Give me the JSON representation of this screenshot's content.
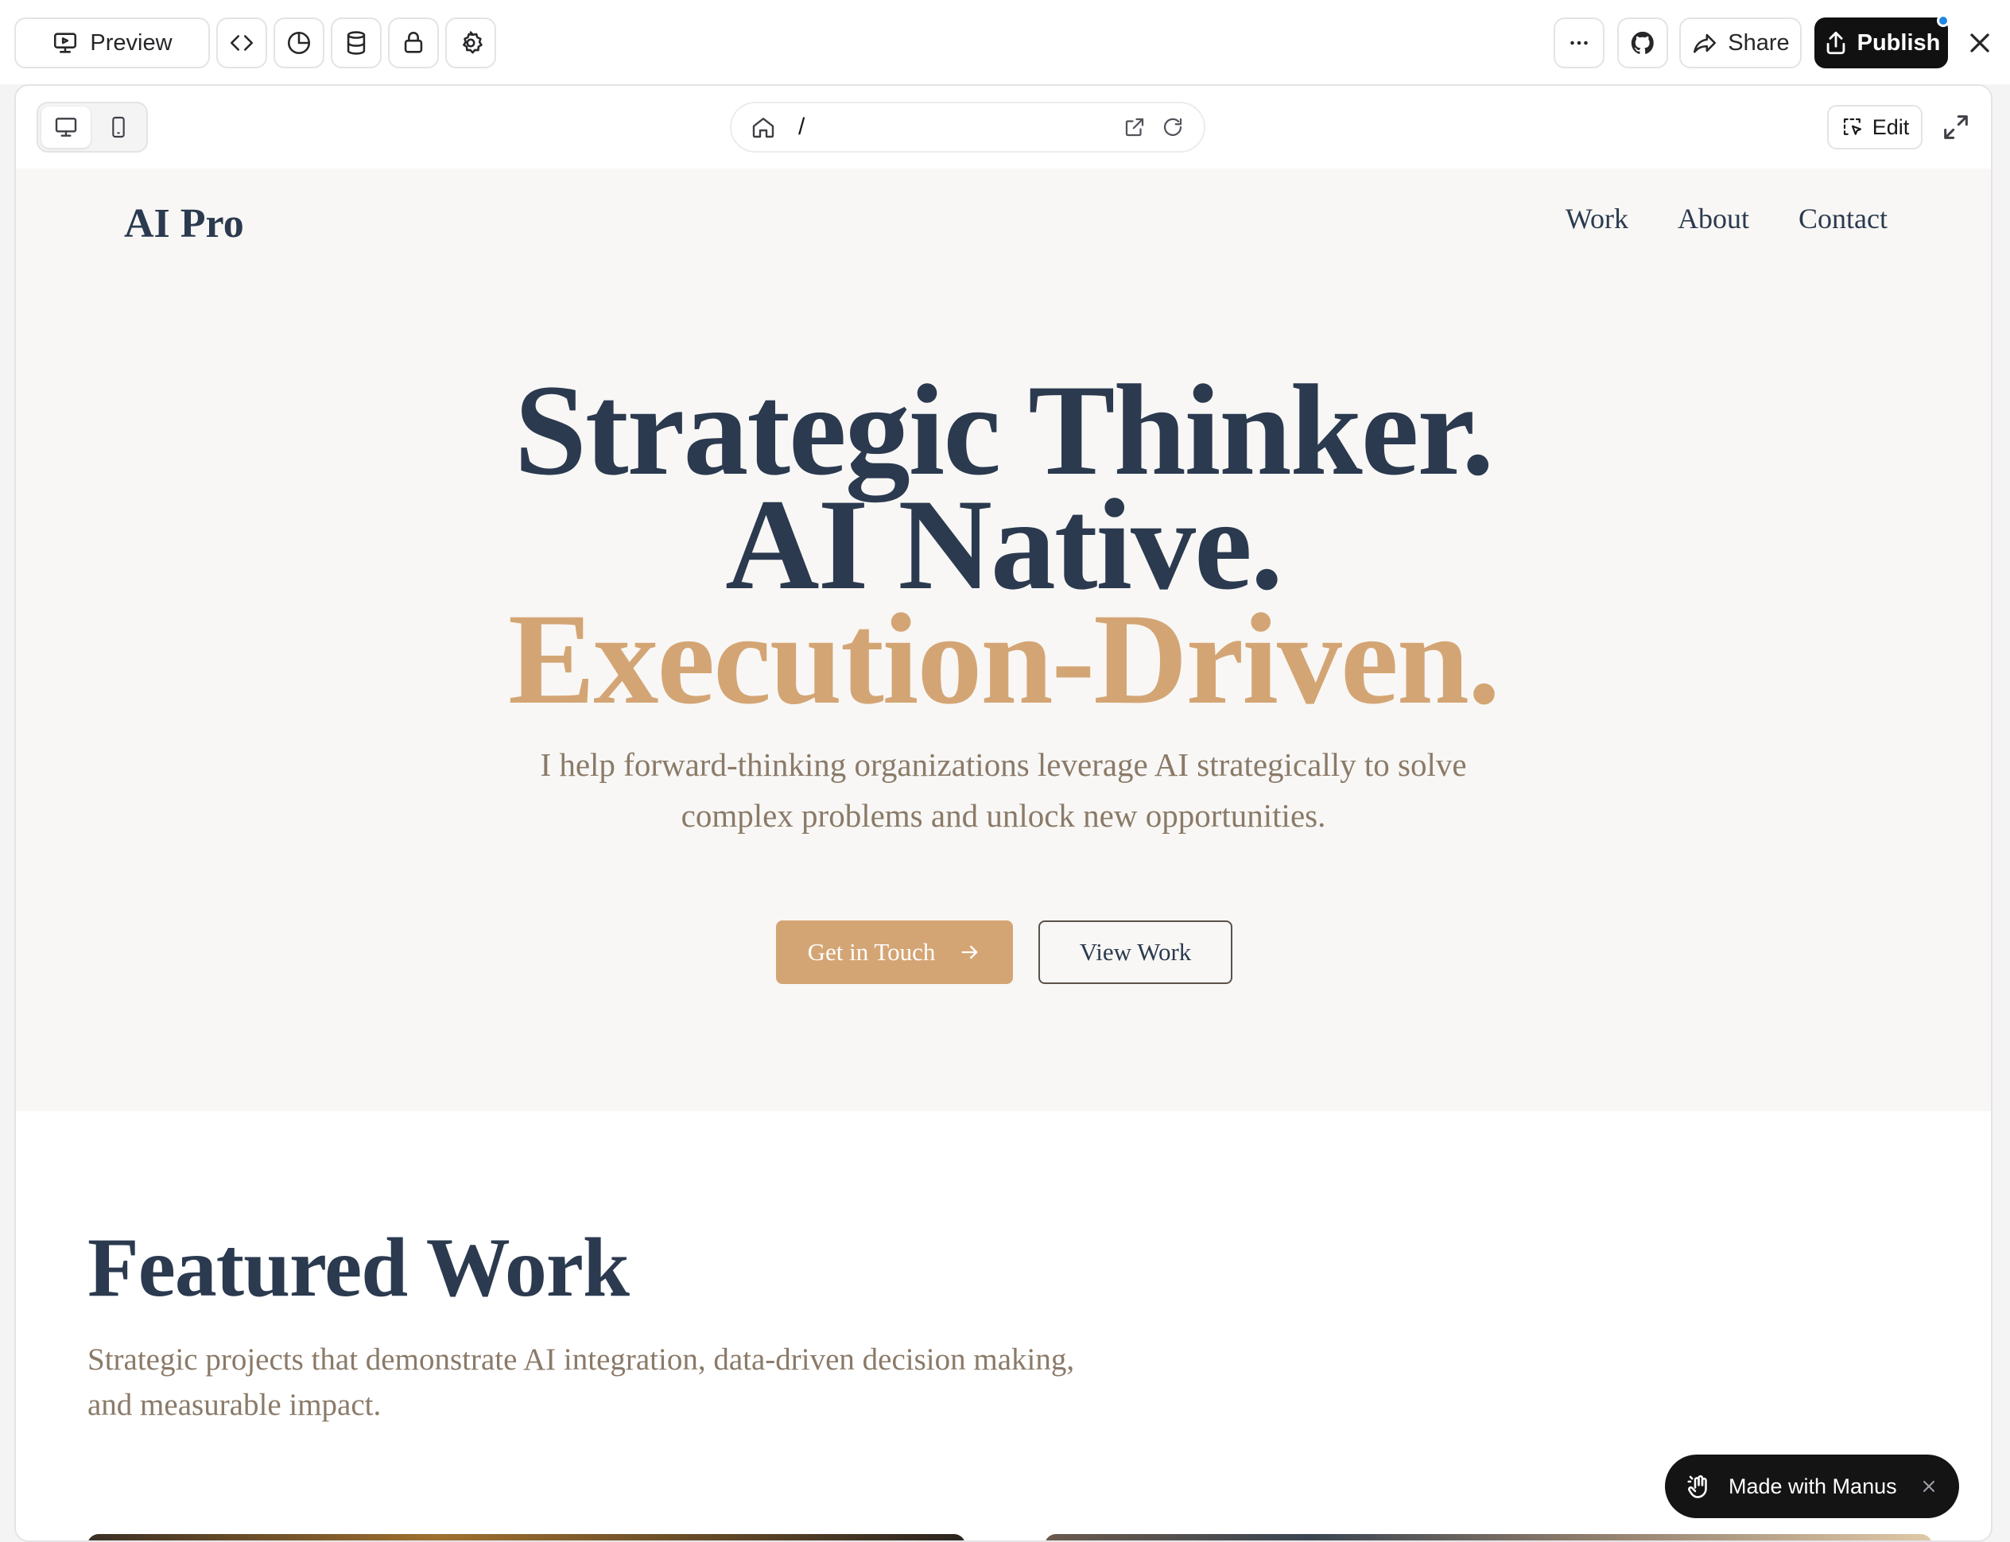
{
  "toolbar": {
    "preview_label": "Preview",
    "share_label": "Share",
    "publish_label": "Publish"
  },
  "browser": {
    "url_path": "/",
    "edit_label": "Edit"
  },
  "site": {
    "logo": "AI Pro",
    "nav": [
      "Work",
      "About",
      "Contact"
    ],
    "hero": {
      "line1": "Strategic Thinker.",
      "line2": "AI Native.",
      "line3": "Execution-Driven.",
      "subtitle_line1": "I help forward-thinking organizations leverage AI strategically to solve",
      "subtitle_line2": "complex problems and unlock new opportunities.",
      "primary_cta": "Get in Touch",
      "secondary_cta": "View Work"
    },
    "featured": {
      "title": "Featured Work",
      "desc_line1": "Strategic projects that demonstrate AI integration, data-driven decision making,",
      "desc_line2": "and measurable impact."
    }
  },
  "badge": {
    "label": "Made with Manus"
  },
  "colors": {
    "accent": "#d4a574",
    "navy": "#2b3a4f",
    "muted_text": "#8a7a68",
    "hero_bg": "#f8f7f5",
    "publish_bg": "#111111",
    "notify_dot": "#1e88e5"
  }
}
